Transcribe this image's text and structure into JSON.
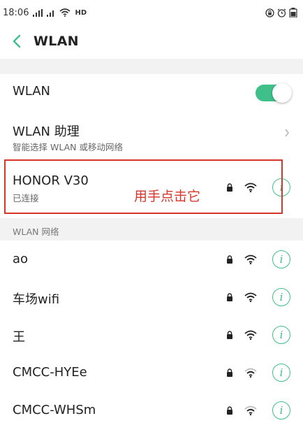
{
  "status_bar": {
    "time": "18:06",
    "network_badge": "HD"
  },
  "header": {
    "title": "WLAN",
    "back_icon": "chevron-left-icon"
  },
  "wlan_toggle": {
    "label": "WLAN",
    "enabled": true
  },
  "assistant": {
    "label": "WLAN 助理",
    "sublabel": "智能选择 WLAN 或移动网络"
  },
  "connected_network": {
    "name": "HONOR V30",
    "status": "已连接"
  },
  "annotation": {
    "text": "用手点击它"
  },
  "networks_section": {
    "header": "WLAN 网络",
    "items": [
      {
        "name": "ao"
      },
      {
        "name": "车场wifi"
      },
      {
        "name": "王"
      },
      {
        "name": "CMCC-HYEe"
      },
      {
        "name": "CMCC-WHSm"
      }
    ]
  },
  "colors": {
    "accent": "#3fbf89",
    "annotation": "#d7372b",
    "section_bg": "#f2f2f2"
  }
}
